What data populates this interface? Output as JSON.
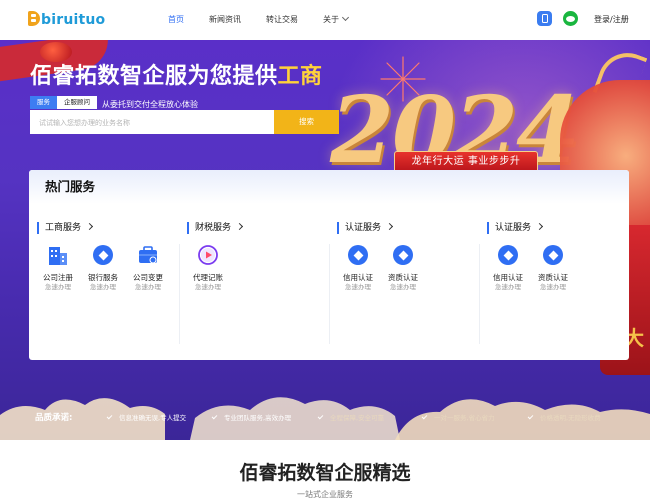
{
  "header": {
    "logo_text": "biruituo",
    "nav": [
      {
        "label": "首页",
        "active": true
      },
      {
        "label": "新闻资讯",
        "active": false
      },
      {
        "label": "转让交易",
        "active": false
      },
      {
        "label": "关于",
        "active": false
      }
    ],
    "login_label": "登录/注册"
  },
  "banner": {
    "title_main": "佰睿拓数智企服为您提供",
    "title_highlight": "工商",
    "subtitle": "企服领域优质平台，从委托到交付全程放心体验",
    "year": "2024",
    "slogan": "龙年行大运 事业步步升",
    "deco_char": "大"
  },
  "search": {
    "tabs": [
      {
        "label": "服务",
        "active": true
      },
      {
        "label": "企服顾问",
        "active": false
      }
    ],
    "placeholder": "试试输入您想办理的业务名称",
    "button_label": "搜索"
  },
  "hot_services": {
    "title": "热门服务",
    "categories": [
      {
        "name": "工商服务",
        "items": [
          {
            "name": "公司注册",
            "sub": "急速办理",
            "icon": "building-icon"
          },
          {
            "name": "银行服务",
            "sub": "急速办理",
            "icon": "diamond-icon"
          },
          {
            "name": "公司变更",
            "sub": "急速办理",
            "icon": "briefcase-icon"
          }
        ]
      },
      {
        "name": "财税服务",
        "items": [
          {
            "name": "代理记账",
            "sub": "急速办理",
            "icon": "play-icon"
          }
        ]
      },
      {
        "name": "认证服务",
        "items": [
          {
            "name": "信用认证",
            "sub": "急速办理",
            "icon": "diamond-icon"
          },
          {
            "name": "资质认证",
            "sub": "急速办理",
            "icon": "diamond-icon"
          }
        ]
      },
      {
        "name": "认证服务",
        "items": [
          {
            "name": "信用认证",
            "sub": "急速办理",
            "icon": "diamond-icon"
          },
          {
            "name": "资质认证",
            "sub": "急速办理",
            "icon": "diamond-icon"
          }
        ]
      }
    ]
  },
  "quality": {
    "label": "品质承诺:",
    "items": [
      "信息准确无误,专人提交",
      "专业团队服务,高效办理",
      "全程保障,安全可靠",
      "一对一服务,省心省力",
      "价格透明,无隐形收费"
    ]
  },
  "section": {
    "title": "佰睿拓数智企服精选",
    "subtitle": "一站式企业服务"
  },
  "colors": {
    "accent": "#2f6ef3",
    "search_button": "#f2b418",
    "banner_top": "#5a2fc8",
    "highlight": "#ffd23a"
  }
}
